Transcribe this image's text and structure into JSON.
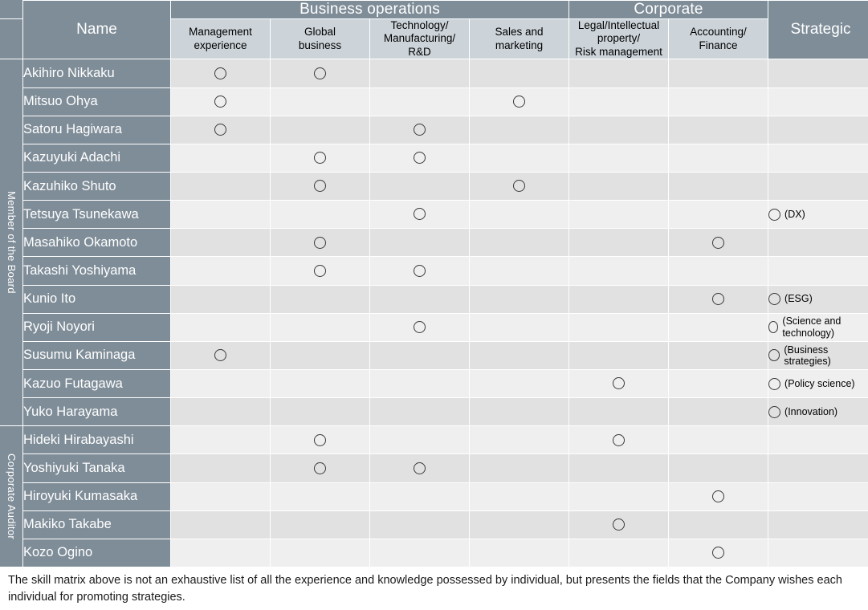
{
  "header": {
    "name_label": "Name",
    "groups": [
      {
        "label": "Business operations",
        "span": 4
      },
      {
        "label": "Corporate",
        "span": 2
      }
    ],
    "strategic_label": "Strategic",
    "subcolumns": [
      "Management\nexperience",
      "Global\nbusiness",
      "Technology/\nManufacturing/\nR&D",
      "Sales and\nmarketing",
      "Legal/Intellectual\nproperty/\nRisk management",
      "Accounting/\nFinance"
    ],
    "sub_management": "Management experience",
    "sub_global": "Global business",
    "sub_technology": "Technology/ Manufacturing/ R&D",
    "sub_sales": "Sales and marketing",
    "sub_legal": "Legal/Intellectual property/ Risk management",
    "sub_accounting": "Accounting/ Finance"
  },
  "row_groups": [
    {
      "label": "Member of the Board",
      "rows": 13
    },
    {
      "label": "Corporate Auditor",
      "rows": 5
    }
  ],
  "colors": {
    "header_dark": "#7f8d98",
    "header_sub": "#ccd4da",
    "row_light": "#efefef",
    "row_alt": "#e1e1e1",
    "mark_stroke": "#3a3a3a",
    "grid": "#ffffff"
  },
  "icons": {
    "mark": "circle-icon"
  },
  "rows": [
    {
      "name": "Akihiro Nikkaku",
      "group": "Member of the Board",
      "management": true,
      "global": true,
      "technology": false,
      "sales": false,
      "legal": false,
      "accounting": false,
      "strategic": false,
      "strategic_label": ""
    },
    {
      "name": "Mitsuo Ohya",
      "group": "Member of the Board",
      "management": true,
      "global": false,
      "technology": false,
      "sales": true,
      "legal": false,
      "accounting": false,
      "strategic": false,
      "strategic_label": ""
    },
    {
      "name": "Satoru Hagiwara",
      "group": "Member of the Board",
      "management": true,
      "global": false,
      "technology": true,
      "sales": false,
      "legal": false,
      "accounting": false,
      "strategic": false,
      "strategic_label": ""
    },
    {
      "name": "Kazuyuki Adachi",
      "group": "Member of the Board",
      "management": false,
      "global": true,
      "technology": true,
      "sales": false,
      "legal": false,
      "accounting": false,
      "strategic": false,
      "strategic_label": ""
    },
    {
      "name": "Kazuhiko Shuto",
      "group": "Member of the Board",
      "management": false,
      "global": true,
      "technology": false,
      "sales": true,
      "legal": false,
      "accounting": false,
      "strategic": false,
      "strategic_label": ""
    },
    {
      "name": "Tetsuya Tsunekawa",
      "group": "Member of the Board",
      "management": false,
      "global": false,
      "technology": true,
      "sales": false,
      "legal": false,
      "accounting": false,
      "strategic": true,
      "strategic_label": "(DX)"
    },
    {
      "name": "Masahiko Okamoto",
      "group": "Member of the Board",
      "management": false,
      "global": true,
      "technology": false,
      "sales": false,
      "legal": false,
      "accounting": true,
      "strategic": false,
      "strategic_label": ""
    },
    {
      "name": "Takashi Yoshiyama",
      "group": "Member of the Board",
      "management": false,
      "global": true,
      "technology": true,
      "sales": false,
      "legal": false,
      "accounting": false,
      "strategic": false,
      "strategic_label": ""
    },
    {
      "name": "Kunio Ito",
      "group": "Member of the Board",
      "management": false,
      "global": false,
      "technology": false,
      "sales": false,
      "legal": false,
      "accounting": true,
      "strategic": true,
      "strategic_label": "(ESG)"
    },
    {
      "name": "Ryoji Noyori",
      "group": "Member of the Board",
      "management": false,
      "global": false,
      "technology": true,
      "sales": false,
      "legal": false,
      "accounting": false,
      "strategic": true,
      "strategic_label": "(Science and technology)"
    },
    {
      "name": "Susumu Kaminaga",
      "group": "Member of the Board",
      "management": true,
      "global": false,
      "technology": false,
      "sales": false,
      "legal": false,
      "accounting": false,
      "strategic": true,
      "strategic_label": "(Business strategies)"
    },
    {
      "name": "Kazuo Futagawa",
      "group": "Member of the Board",
      "management": false,
      "global": false,
      "technology": false,
      "sales": false,
      "legal": true,
      "accounting": false,
      "strategic": true,
      "strategic_label": "(Policy science)"
    },
    {
      "name": "Yuko Harayama",
      "group": "Member of the Board",
      "management": false,
      "global": false,
      "technology": false,
      "sales": false,
      "legal": false,
      "accounting": false,
      "strategic": true,
      "strategic_label": "(Innovation)"
    },
    {
      "name": "Hideki Hirabayashi",
      "group": "Corporate Auditor",
      "management": false,
      "global": true,
      "technology": false,
      "sales": false,
      "legal": true,
      "accounting": false,
      "strategic": false,
      "strategic_label": ""
    },
    {
      "name": "Yoshiyuki Tanaka",
      "group": "Corporate Auditor",
      "management": false,
      "global": true,
      "technology": true,
      "sales": false,
      "legal": false,
      "accounting": false,
      "strategic": false,
      "strategic_label": ""
    },
    {
      "name": "Hiroyuki Kumasaka",
      "group": "Corporate Auditor",
      "management": false,
      "global": false,
      "technology": false,
      "sales": false,
      "legal": false,
      "accounting": true,
      "strategic": false,
      "strategic_label": ""
    },
    {
      "name": "Makiko Takabe",
      "group": "Corporate Auditor",
      "management": false,
      "global": false,
      "technology": false,
      "sales": false,
      "legal": true,
      "accounting": false,
      "strategic": false,
      "strategic_label": ""
    },
    {
      "name": "Kozo Ogino",
      "group": "Corporate Auditor",
      "management": false,
      "global": false,
      "technology": false,
      "sales": false,
      "legal": false,
      "accounting": true,
      "strategic": false,
      "strategic_label": ""
    }
  ],
  "note": "The skill matrix above is not an exhaustive list of all the experience and knowledge possessed by individual, but presents the fields that the Company wishes each individual for promoting strategies."
}
